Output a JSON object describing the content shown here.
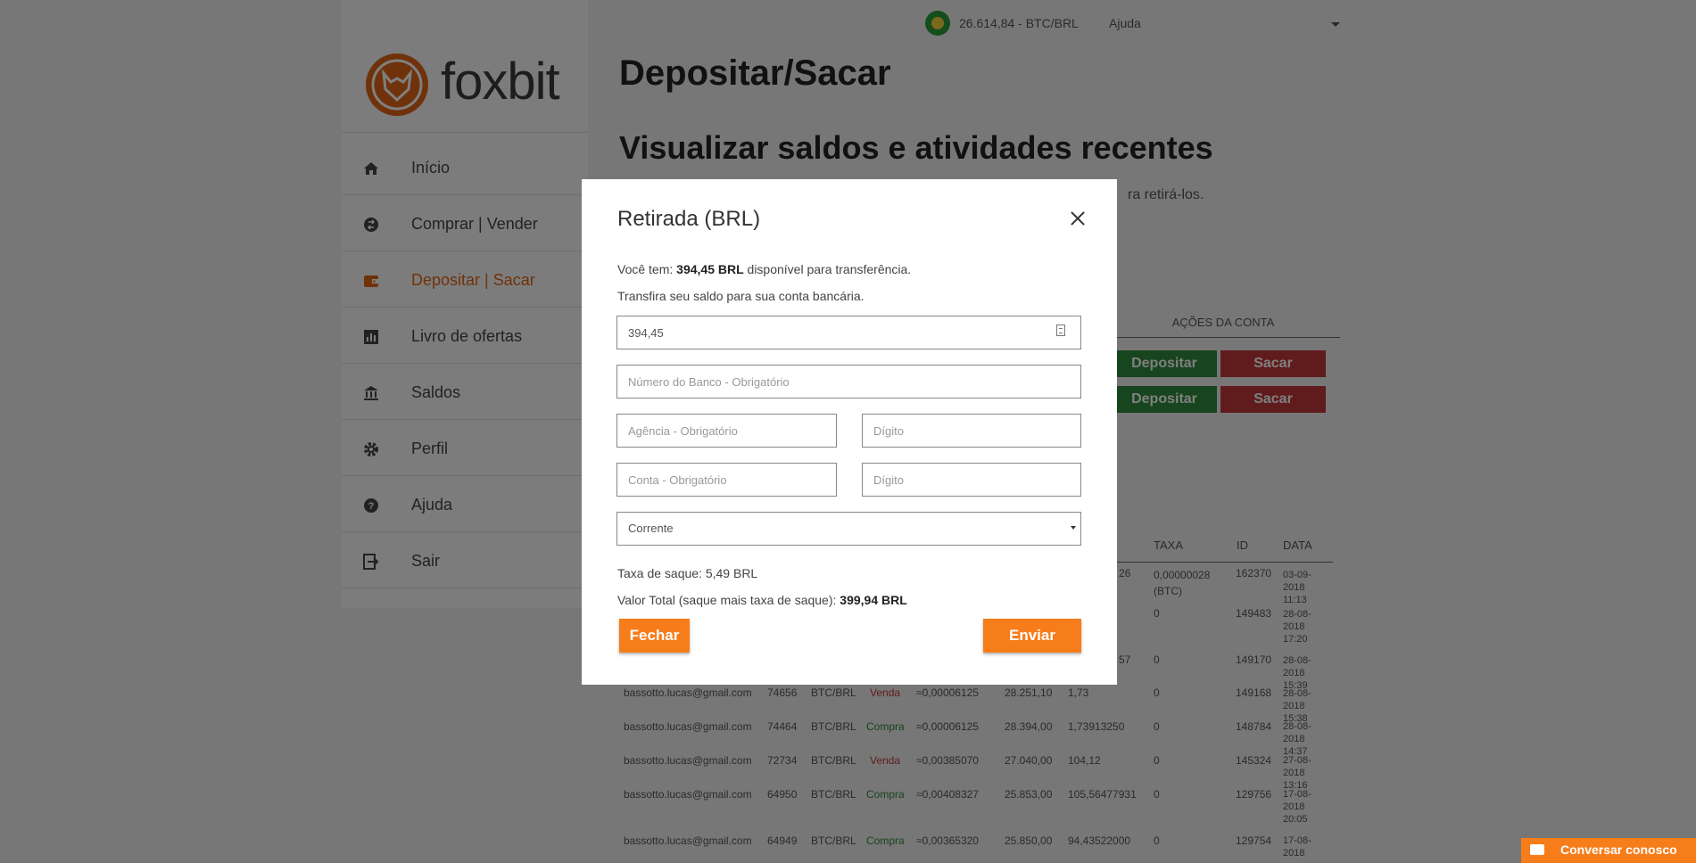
{
  "topbar": {
    "price": "26.614,84 - BTC/BRL",
    "help": "Ajuda"
  },
  "logo": {
    "text": "foxbit"
  },
  "nav": [
    {
      "label": "Início",
      "icon": "home-icon",
      "active": false
    },
    {
      "label": "Comprar | Vender",
      "icon": "exchange-icon",
      "active": false
    },
    {
      "label": "Depositar | Sacar",
      "icon": "wallet-icon",
      "active": true
    },
    {
      "label": "Livro de ofertas",
      "icon": "chart-icon",
      "active": false
    },
    {
      "label": "Saldos",
      "icon": "bank-icon",
      "active": false
    },
    {
      "label": "Perfil",
      "icon": "gear-icon",
      "active": false
    },
    {
      "label": "Ajuda",
      "icon": "help-icon",
      "active": false
    },
    {
      "label": "Sair",
      "icon": "logout-icon",
      "active": false
    }
  ],
  "page": {
    "title": "Depositar/Sacar",
    "section_title": "Visualizar saldos e atividades recentes",
    "section_desc_tail": "ra retirá-los.",
    "account_actions_header": "AÇÕES DA CONTA",
    "deposit_label": "Depositar",
    "withdraw_label": "Sacar"
  },
  "table": {
    "headers": [
      "TAXA",
      "ID",
      "DATA"
    ],
    "rows": [
      {
        "email": "",
        "order": "",
        "pair": "",
        "side": "",
        "side_type": "",
        "amount": "",
        "price": "",
        "total": "26",
        "fee": "0,00000028 (BTC)",
        "id": "162370",
        "date": "03-09-2018 11:13"
      },
      {
        "email": "",
        "order": "",
        "pair": "",
        "side": "",
        "side_type": "",
        "amount": "",
        "price": "",
        "total": "",
        "fee": "0",
        "id": "149483",
        "date": "28-08-2018 17:20"
      },
      {
        "email": "",
        "order": "",
        "pair": "",
        "side": "",
        "side_type": "",
        "amount": "",
        "price": "",
        "total": "57",
        "fee": "0",
        "id": "149170",
        "date": "28-08-2018 15:39"
      },
      {
        "email": "bassotto.lucas@gmail.com",
        "order": "74656",
        "pair": "BTC/BRL",
        "side": "Venda",
        "side_type": "sell",
        "amount": "≈0,00006125",
        "price": "28.251,10",
        "total": "1,73",
        "fee": "0",
        "id": "149168",
        "date": "28-08-2018 15:38"
      },
      {
        "email": "bassotto.lucas@gmail.com",
        "order": "74464",
        "pair": "BTC/BRL",
        "side": "Compra",
        "side_type": "buy",
        "amount": "≈0,00006125",
        "price": "28.394,00",
        "total": "1,73913250",
        "fee": "0",
        "id": "148784",
        "date": "28-08-2018 14:37"
      },
      {
        "email": "bassotto.lucas@gmail.com",
        "order": "72734",
        "pair": "BTC/BRL",
        "side": "Venda",
        "side_type": "sell",
        "amount": "≈0,00385070",
        "price": "27.040,00",
        "total": "104,12",
        "fee": "0",
        "id": "145324",
        "date": "27-08-2018 13:16"
      },
      {
        "email": "bassotto.lucas@gmail.com",
        "order": "64950",
        "pair": "BTC/BRL",
        "side": "Compra",
        "side_type": "buy",
        "amount": "≈0,00408327",
        "price": "25.853,00",
        "total": "105,56477931",
        "fee": "0",
        "id": "129756",
        "date": "17-08-2018 20:05"
      },
      {
        "email": "bassotto.lucas@gmail.com",
        "order": "64949",
        "pair": "BTC/BRL",
        "side": "Compra",
        "side_type": "buy",
        "amount": "≈0,00365320",
        "price": "25.850,00",
        "total": "94,43522000",
        "fee": "0",
        "id": "129754",
        "date": "17-08-2018"
      }
    ]
  },
  "modal": {
    "title": "Retirada (BRL)",
    "available_prefix": "Você tem: ",
    "available_amount": "394,45 BRL",
    "available_suffix": " disponível para transferência.",
    "transfer_text": "Transfira seu saldo para sua conta bancária.",
    "amount_value": "394,45",
    "bank_placeholder": "Número do Banco - Obrigatório",
    "agency_placeholder": "Agência - Obrigatório",
    "agency_digit_placeholder": "Dígito",
    "account_placeholder": "Conta - Obrigatório",
    "account_digit_placeholder": "Dígito",
    "account_type": "Corrente",
    "fee_text": "Taxa de saque: 5,49 BRL",
    "total_prefix": "Valor Total (saque mais taxa de saque): ",
    "total_amount": "399,94 BRL",
    "close_label": "Fechar",
    "submit_label": "Enviar"
  },
  "chat": {
    "label": "Conversar conosco"
  },
  "colors": {
    "accent": "#f77d1a",
    "active_nav": "#e06414",
    "green": "#2e8a3a",
    "red": "#c0393b"
  }
}
